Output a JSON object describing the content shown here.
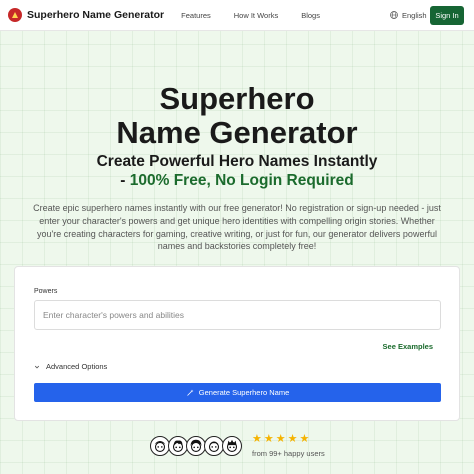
{
  "header": {
    "brand": "Superhero Name Generator",
    "nav": [
      "Features",
      "How It Works",
      "Blogs"
    ],
    "language": "English",
    "signin_label": "Sign In"
  },
  "hero": {
    "title_line1": "Superhero",
    "title_line2": "Name Generator",
    "subtitle_line1": "Create Powerful Hero Names Instantly",
    "subtitle_dash": "- ",
    "subtitle_accent": "100% Free, No Login Required",
    "description": "Create epic superhero names instantly with our free generator! No registration or sign-up needed - just enter your character's powers and get unique hero identities with compelling origin stories. Whether you're creating characters for gaming, creative writing, or just for fun, our generator delivers powerful names and backstories completely free!"
  },
  "form": {
    "powers_label": "Powers",
    "powers_placeholder": "Enter character's powers and abilities",
    "powers_value": "",
    "see_examples": "See Examples",
    "advanced_options": "Advanced Options",
    "generate_label": "Generate Superhero Name"
  },
  "social": {
    "rating_stars": 5,
    "happy_users": "from 99+ happy users"
  },
  "colors": {
    "accent_green": "#1b6b2d",
    "signin_bg": "#166534",
    "primary_blue": "#2563eb",
    "star": "#f5b301",
    "logo_red": "#c62828"
  },
  "icons": [
    "logo-icon",
    "globe-icon",
    "chevron-down-icon",
    "moon-icon",
    "magic-wand-icon",
    "avatar-icon",
    "star-icon"
  ]
}
